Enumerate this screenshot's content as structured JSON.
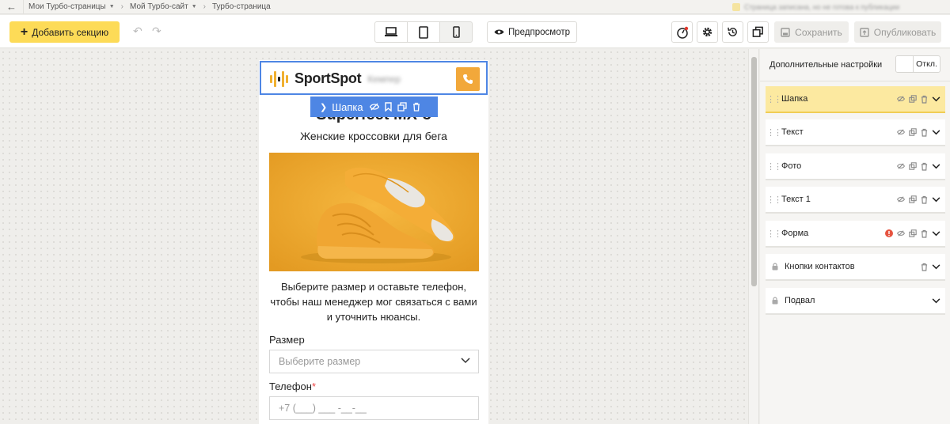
{
  "breadcrumbs": [
    {
      "label": "Мои Турбо-страницы",
      "dropdown": true
    },
    {
      "label": "Мой Турбо-сайт",
      "dropdown": true
    },
    {
      "label": "Турбо-страница",
      "dropdown": false
    }
  ],
  "notice_text": "Страница записана, но не готова к публикации",
  "toolbar": {
    "add_section_label": "Добавить секцию",
    "preview_label": "Предпросмотр",
    "save_label": "Сохранить",
    "publish_label": "Опубликовать",
    "devices": [
      "desktop",
      "tablet",
      "mobile"
    ],
    "active_device": "mobile"
  },
  "page": {
    "brand_name": "SportSpot",
    "brand_tagline": "Кемпер",
    "section_toolbar_label": "Шапка",
    "title": "Superfeet MX-8",
    "subtitle": "Женские кроссовки для бега",
    "description": "Выберите размер и оставьте телефон, чтобы наш менеджер мог связаться с вами и уточнить нюансы.",
    "size_label": "Размер",
    "size_placeholder": "Выберите размер",
    "phone_label": "Телефон",
    "phone_required_mark": "*",
    "phone_placeholder": "+7 (___) ___ -__-__"
  },
  "panel": {
    "advanced_label": "Дополнительные настройки",
    "toggle_label": "Откл.",
    "sections": [
      {
        "label": "Шапка",
        "active": true
      },
      {
        "label": "Текст",
        "active": false
      },
      {
        "label": "Фото",
        "active": false
      },
      {
        "label": "Текст 1",
        "active": false
      },
      {
        "label": "Форма",
        "active": false,
        "warning": true
      },
      {
        "label": "Кнопки контактов",
        "locked": true
      },
      {
        "label": "Подвал",
        "locked": true
      }
    ]
  },
  "colors": {
    "accent_yellow": "#fddb57",
    "selection_blue": "#4e86e4",
    "shoe_orange": "#f1a830",
    "active_row": "#fce9a0",
    "warning_red": "#e65440"
  }
}
